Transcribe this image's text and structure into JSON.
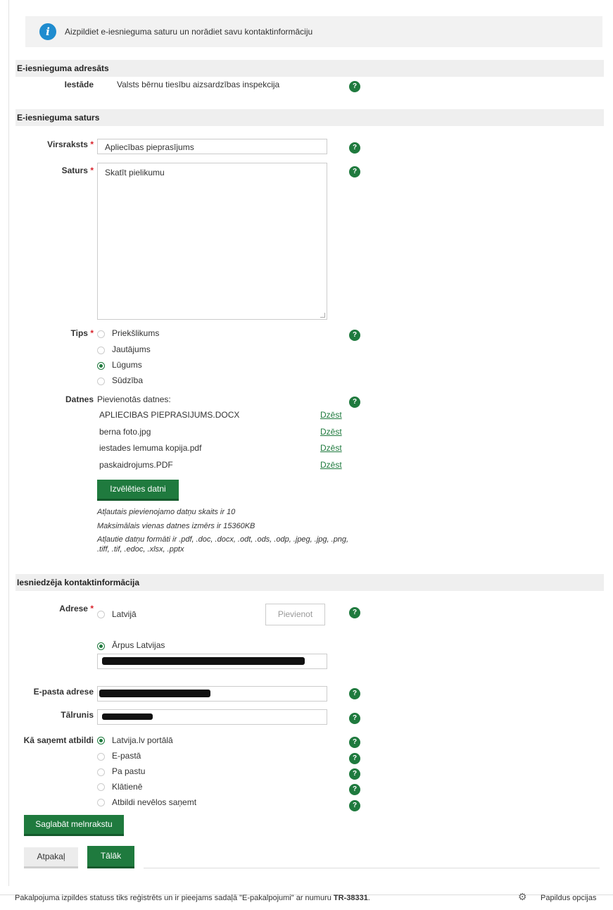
{
  "info": {
    "text": "Aizpildiet e-iesnieguma saturu un norādiet savu kontaktinformāciju"
  },
  "sections": {
    "addressee": "E-iesnieguma adresāts",
    "content": "E-iesnieguma saturs",
    "contact": "Iesniedzēja kontaktinformācija"
  },
  "addressee": {
    "label": "Iestāde",
    "value": "Valsts bērnu tiesību aizsardzības inspekcija"
  },
  "form": {
    "title_label": "Virsraksts",
    "title_value": "Apliecības pieprasījums",
    "content_label": "Saturs",
    "content_value": "Skatīt pielikumu",
    "type_label": "Tips",
    "type_options": [
      "Priekšlikums",
      "Jautājums",
      "Lūgums",
      "Sūdzība"
    ],
    "type_selected": "Lūgums",
    "files_label": "Datnes",
    "files_heading": "Pievienotās datnes:",
    "files": [
      {
        "name": "APLIECIBAS PIEPRASIJUMS.DOCX",
        "action": "Dzēst"
      },
      {
        "name": "berna foto.jpg",
        "action": "Dzēst"
      },
      {
        "name": "iestades lemuma kopija.pdf",
        "action": "Dzēst"
      },
      {
        "name": "paskaidrojums.PDF",
        "action": "Dzēst"
      }
    ],
    "choose_file": "Izvēlēties datni",
    "notes": [
      "Atļautais pievienojamo datņu skaits ir 10",
      "Maksimālais vienas datnes izmērs ir 15360KB",
      "Atļautie datņu formāti ir .pdf, .doc, .docx, .odt, .ods, .odp, .jpeg, .jpg, .png, .tiff, .tif, .edoc, .xlsx, .pptx"
    ]
  },
  "contact": {
    "address_label": "Adrese",
    "addr_option_lv": "Latvijā",
    "addr_add": "Pievienot",
    "addr_option_abroad": "Ārpus Latvijas",
    "email_label": "E-pasta adrese",
    "phone_label": "Tālrunis",
    "reply_label": "Kā saņemt atbildi",
    "reply_options": [
      "Latvija.lv portālā",
      "E-pastā",
      "Pa pastu",
      "Klātienē",
      "Atbildi nevēlos saņemt"
    ],
    "reply_selected": "Latvija.lv portālā"
  },
  "buttons": {
    "save_draft": "Saglabāt melnrakstu",
    "back": "Atpakaļ",
    "next": "Tālāk"
  },
  "footer": {
    "text_before": "Pakalpojuma izpildes statuss tiks reģistrēts un ir pieejams sadaļā \"E-pakalpojumi\" ar numuru ",
    "number": "TR-38331",
    "text_after": ".",
    "options": "Papildus opcijas"
  },
  "help_symbol": "?",
  "required_mark": "*",
  "colors": {
    "accent": "#1f7a3e",
    "info": "#1f8ccf",
    "required": "#d9232b"
  }
}
